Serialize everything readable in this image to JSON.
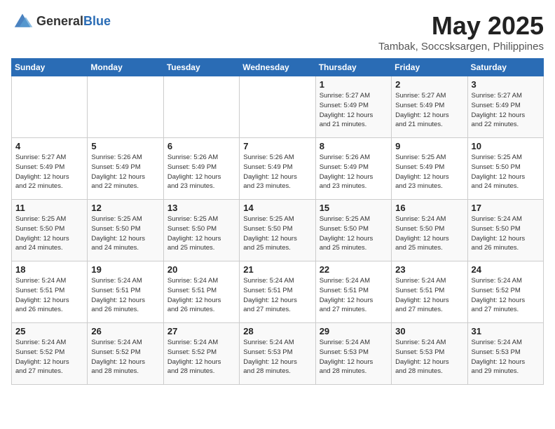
{
  "logo": {
    "general": "General",
    "blue": "Blue"
  },
  "title": "May 2025",
  "subtitle": "Tambak, Soccsksargen, Philippines",
  "days_of_week": [
    "Sunday",
    "Monday",
    "Tuesday",
    "Wednesday",
    "Thursday",
    "Friday",
    "Saturday"
  ],
  "weeks": [
    [
      {
        "day": "",
        "info": ""
      },
      {
        "day": "",
        "info": ""
      },
      {
        "day": "",
        "info": ""
      },
      {
        "day": "",
        "info": ""
      },
      {
        "day": "1",
        "info": "Sunrise: 5:27 AM\nSunset: 5:49 PM\nDaylight: 12 hours\nand 21 minutes."
      },
      {
        "day": "2",
        "info": "Sunrise: 5:27 AM\nSunset: 5:49 PM\nDaylight: 12 hours\nand 21 minutes."
      },
      {
        "day": "3",
        "info": "Sunrise: 5:27 AM\nSunset: 5:49 PM\nDaylight: 12 hours\nand 22 minutes."
      }
    ],
    [
      {
        "day": "4",
        "info": "Sunrise: 5:27 AM\nSunset: 5:49 PM\nDaylight: 12 hours\nand 22 minutes."
      },
      {
        "day": "5",
        "info": "Sunrise: 5:26 AM\nSunset: 5:49 PM\nDaylight: 12 hours\nand 22 minutes."
      },
      {
        "day": "6",
        "info": "Sunrise: 5:26 AM\nSunset: 5:49 PM\nDaylight: 12 hours\nand 23 minutes."
      },
      {
        "day": "7",
        "info": "Sunrise: 5:26 AM\nSunset: 5:49 PM\nDaylight: 12 hours\nand 23 minutes."
      },
      {
        "day": "8",
        "info": "Sunrise: 5:26 AM\nSunset: 5:49 PM\nDaylight: 12 hours\nand 23 minutes."
      },
      {
        "day": "9",
        "info": "Sunrise: 5:25 AM\nSunset: 5:49 PM\nDaylight: 12 hours\nand 23 minutes."
      },
      {
        "day": "10",
        "info": "Sunrise: 5:25 AM\nSunset: 5:50 PM\nDaylight: 12 hours\nand 24 minutes."
      }
    ],
    [
      {
        "day": "11",
        "info": "Sunrise: 5:25 AM\nSunset: 5:50 PM\nDaylight: 12 hours\nand 24 minutes."
      },
      {
        "day": "12",
        "info": "Sunrise: 5:25 AM\nSunset: 5:50 PM\nDaylight: 12 hours\nand 24 minutes."
      },
      {
        "day": "13",
        "info": "Sunrise: 5:25 AM\nSunset: 5:50 PM\nDaylight: 12 hours\nand 25 minutes."
      },
      {
        "day": "14",
        "info": "Sunrise: 5:25 AM\nSunset: 5:50 PM\nDaylight: 12 hours\nand 25 minutes."
      },
      {
        "day": "15",
        "info": "Sunrise: 5:25 AM\nSunset: 5:50 PM\nDaylight: 12 hours\nand 25 minutes."
      },
      {
        "day": "16",
        "info": "Sunrise: 5:24 AM\nSunset: 5:50 PM\nDaylight: 12 hours\nand 25 minutes."
      },
      {
        "day": "17",
        "info": "Sunrise: 5:24 AM\nSunset: 5:50 PM\nDaylight: 12 hours\nand 26 minutes."
      }
    ],
    [
      {
        "day": "18",
        "info": "Sunrise: 5:24 AM\nSunset: 5:51 PM\nDaylight: 12 hours\nand 26 minutes."
      },
      {
        "day": "19",
        "info": "Sunrise: 5:24 AM\nSunset: 5:51 PM\nDaylight: 12 hours\nand 26 minutes."
      },
      {
        "day": "20",
        "info": "Sunrise: 5:24 AM\nSunset: 5:51 PM\nDaylight: 12 hours\nand 26 minutes."
      },
      {
        "day": "21",
        "info": "Sunrise: 5:24 AM\nSunset: 5:51 PM\nDaylight: 12 hours\nand 27 minutes."
      },
      {
        "day": "22",
        "info": "Sunrise: 5:24 AM\nSunset: 5:51 PM\nDaylight: 12 hours\nand 27 minutes."
      },
      {
        "day": "23",
        "info": "Sunrise: 5:24 AM\nSunset: 5:51 PM\nDaylight: 12 hours\nand 27 minutes."
      },
      {
        "day": "24",
        "info": "Sunrise: 5:24 AM\nSunset: 5:52 PM\nDaylight: 12 hours\nand 27 minutes."
      }
    ],
    [
      {
        "day": "25",
        "info": "Sunrise: 5:24 AM\nSunset: 5:52 PM\nDaylight: 12 hours\nand 27 minutes."
      },
      {
        "day": "26",
        "info": "Sunrise: 5:24 AM\nSunset: 5:52 PM\nDaylight: 12 hours\nand 28 minutes."
      },
      {
        "day": "27",
        "info": "Sunrise: 5:24 AM\nSunset: 5:52 PM\nDaylight: 12 hours\nand 28 minutes."
      },
      {
        "day": "28",
        "info": "Sunrise: 5:24 AM\nSunset: 5:53 PM\nDaylight: 12 hours\nand 28 minutes."
      },
      {
        "day": "29",
        "info": "Sunrise: 5:24 AM\nSunset: 5:53 PM\nDaylight: 12 hours\nand 28 minutes."
      },
      {
        "day": "30",
        "info": "Sunrise: 5:24 AM\nSunset: 5:53 PM\nDaylight: 12 hours\nand 28 minutes."
      },
      {
        "day": "31",
        "info": "Sunrise: 5:24 AM\nSunset: 5:53 PM\nDaylight: 12 hours\nand 29 minutes."
      }
    ]
  ]
}
